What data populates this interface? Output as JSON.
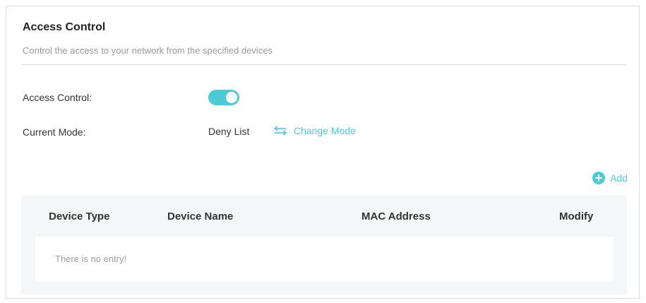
{
  "section": {
    "title": "Access Control",
    "subtitle": "Control the access to your network from the specified devices"
  },
  "settings": {
    "access_control_label": "Access Control:",
    "access_control_enabled": true,
    "current_mode_label": "Current Mode:",
    "current_mode_value": "Deny List",
    "change_mode_label": "Change Mode"
  },
  "toolbar": {
    "add_label": "Add"
  },
  "table": {
    "columns": [
      "Device Type",
      "Device Name",
      "MAC Address",
      "Modify"
    ],
    "empty_message": "There is no entry!"
  },
  "colors": {
    "accent": "#4acbd6",
    "border": "#dedede",
    "table_bg": "#f5f6f8"
  },
  "icons": {
    "change_mode": "swap-arrows-icon",
    "add": "plus-circle-icon"
  }
}
